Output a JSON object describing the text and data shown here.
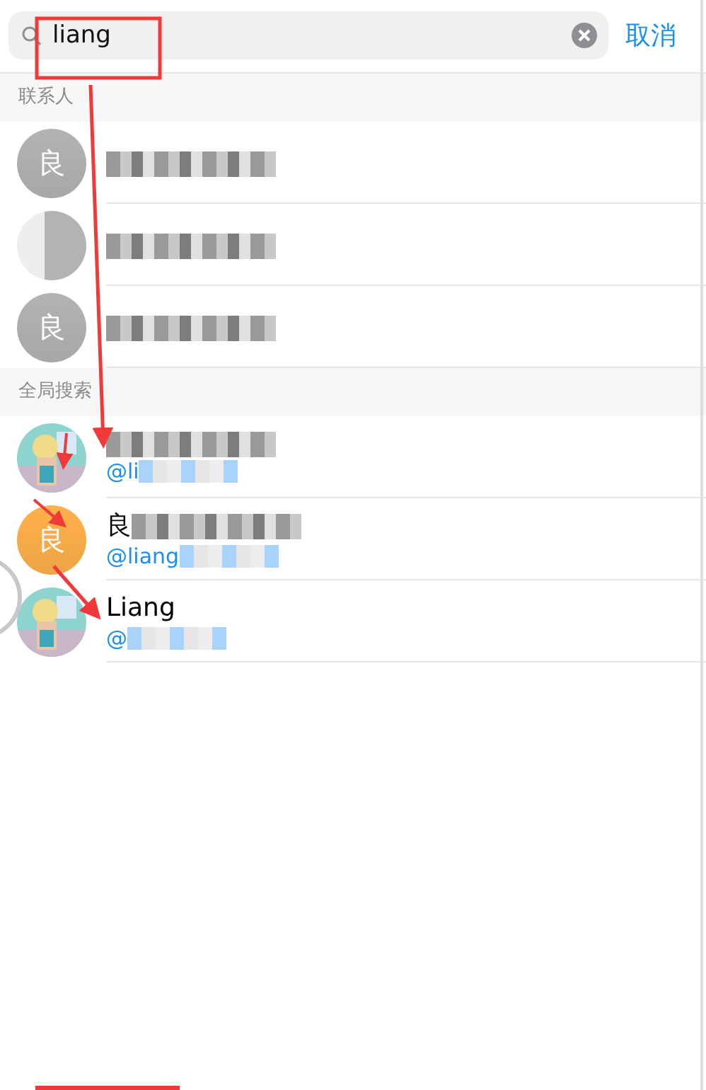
{
  "search": {
    "value": "liang"
  },
  "cancel": "取消",
  "sections": [
    {
      "title": "联系人",
      "rows": [
        {
          "avatar": {
            "kind": "letter",
            "letter": "良",
            "color": "#b3b3b3"
          },
          "title_blurred": true
        },
        {
          "avatar": {
            "kind": "blurred",
            "color": "#b3b3b3"
          },
          "title_blurred": true
        },
        {
          "avatar": {
            "kind": "letter",
            "letter": "良",
            "color": "#b3b3b3"
          },
          "title_blurred": true
        }
      ]
    },
    {
      "title": "全局搜索",
      "rows": [
        {
          "title_blurred": true,
          "username": "@li",
          "username_blurred": true
        },
        {
          "avatar": {
            "kind": "letter",
            "letter": "良",
            "color": "#ffb04a"
          },
          "title": "良",
          "title_blurred": true,
          "username": "@liang",
          "username_blurred": true
        },
        {
          "title": "Liang",
          "title_blurred": false,
          "username": "@",
          "username_blurred": true
        }
      ]
    }
  ]
}
